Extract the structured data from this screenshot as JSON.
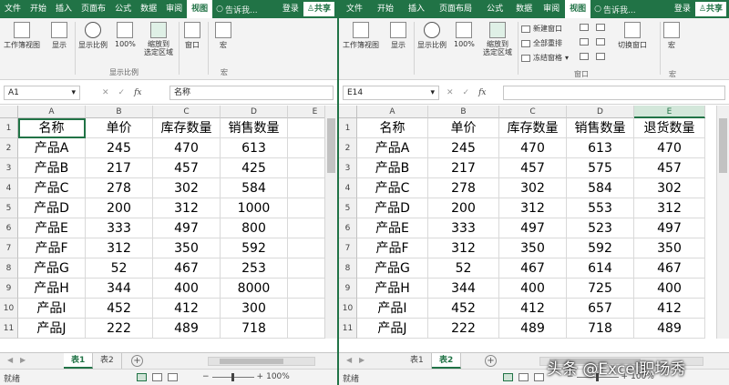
{
  "left": {
    "tabs": [
      "文件",
      "开始",
      "插入",
      "页面布",
      "公式",
      "数据",
      "审阅",
      "视图"
    ],
    "active_tab": "视图",
    "tell_me": "告诉我...",
    "login": "登录",
    "share": "共享",
    "ribbon": {
      "workbook_views": "工作簿视图",
      "show": "显示",
      "zoom": "显示比例",
      "zoom100": "100%",
      "zoom_selection": "缩放到\n选定区域",
      "group_zoom": "显示比例",
      "window": "窗口",
      "macros": "宏",
      "group_macros": "宏"
    },
    "name_box": "A1",
    "formula": "名称",
    "columns": [
      "A",
      "B",
      "C",
      "D",
      "E"
    ],
    "rows": [
      [
        "名称",
        "单价",
        "库存数量",
        "销售数量",
        ""
      ],
      [
        "产品A",
        "245",
        "470",
        "613",
        ""
      ],
      [
        "产品B",
        "217",
        "457",
        "425",
        ""
      ],
      [
        "产品C",
        "278",
        "302",
        "584",
        ""
      ],
      [
        "产品D",
        "200",
        "312",
        "1000",
        ""
      ],
      [
        "产品E",
        "333",
        "497",
        "800",
        ""
      ],
      [
        "产品F",
        "312",
        "350",
        "592",
        ""
      ],
      [
        "产品G",
        "52",
        "467",
        "253",
        ""
      ],
      [
        "产品H",
        "344",
        "400",
        "8000",
        ""
      ],
      [
        "产品I",
        "452",
        "412",
        "300",
        ""
      ],
      [
        "产品J",
        "222",
        "489",
        "718",
        ""
      ]
    ],
    "sheets": [
      "表1",
      "表2"
    ],
    "active_sheet": "表1",
    "status": "就绪",
    "zoom_level": "100%"
  },
  "right": {
    "tabs": [
      "文件",
      "开始",
      "插入",
      "页面布局",
      "公式",
      "数据",
      "审阅",
      "视图"
    ],
    "active_tab": "视图",
    "tell_me": "告诉我...",
    "login": "登录",
    "share": "共享",
    "ribbon": {
      "workbook_views": "工作簿视图",
      "show": "显示",
      "zoom": "显示比例",
      "zoom100": "100%",
      "zoom_selection": "缩放到\n选定区域",
      "new_window": "新建窗口",
      "arrange_all": "全部重排",
      "freeze_panes": "冻结窗格",
      "switch_windows": "切换窗口",
      "group_window": "窗口",
      "macros": "宏",
      "group_macros": "宏"
    },
    "name_box": "E14",
    "formula": "",
    "columns": [
      "A",
      "B",
      "C",
      "D",
      "E"
    ],
    "rows": [
      [
        "名称",
        "单价",
        "库存数量",
        "销售数量",
        "退货数量"
      ],
      [
        "产品A",
        "245",
        "470",
        "613",
        "470"
      ],
      [
        "产品B",
        "217",
        "457",
        "575",
        "457"
      ],
      [
        "产品C",
        "278",
        "302",
        "584",
        "302"
      ],
      [
        "产品D",
        "200",
        "312",
        "553",
        "312"
      ],
      [
        "产品E",
        "333",
        "497",
        "523",
        "497"
      ],
      [
        "产品F",
        "312",
        "350",
        "592",
        "350"
      ],
      [
        "产品G",
        "52",
        "467",
        "614",
        "467"
      ],
      [
        "产品H",
        "344",
        "400",
        "725",
        "400"
      ],
      [
        "产品I",
        "452",
        "412",
        "657",
        "412"
      ],
      [
        "产品J",
        "222",
        "489",
        "718",
        "489"
      ]
    ],
    "sheets": [
      "表1",
      "表2"
    ],
    "active_sheet": "表2",
    "status": "就绪",
    "zoom_level": "100%"
  },
  "watermark": "头条 @Excel职场秀",
  "colors": {
    "accent": "#217346",
    "ribbon": "#f3f3f3",
    "header": "#f0f0f0"
  }
}
